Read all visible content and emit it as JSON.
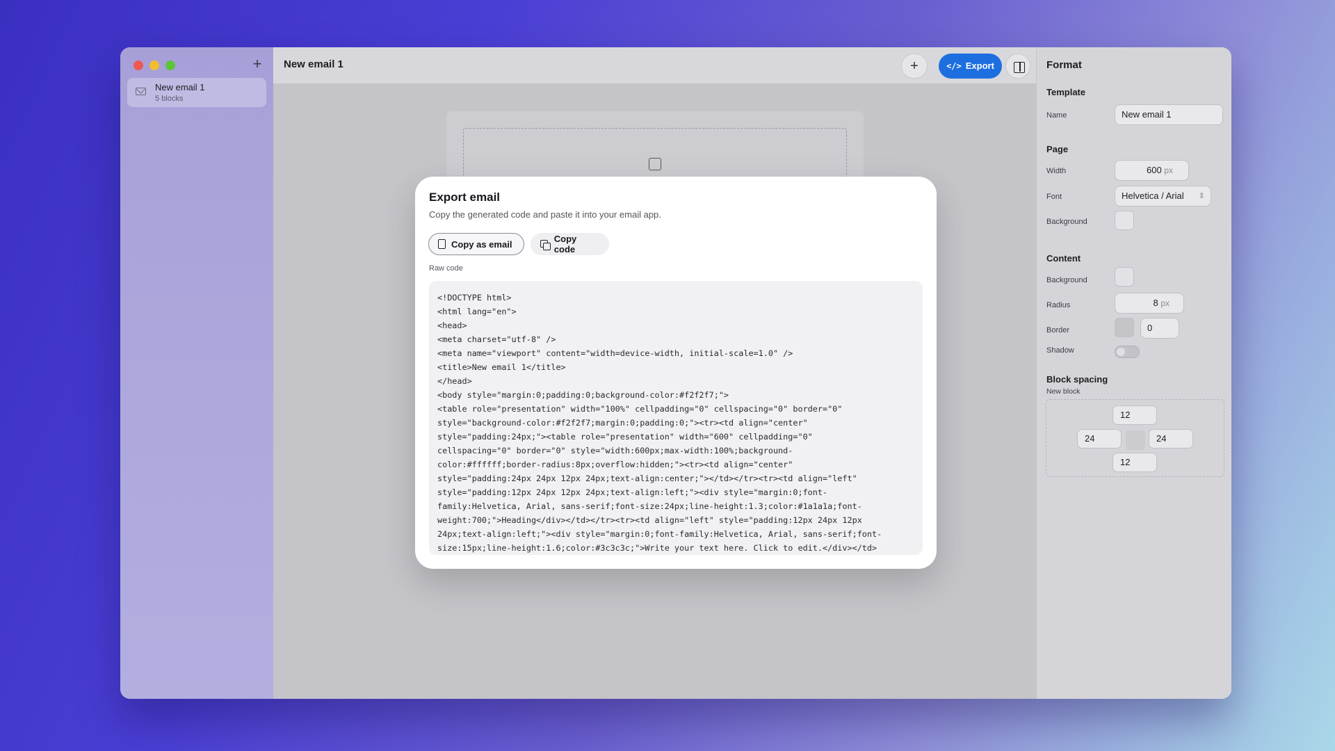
{
  "sidebar": {
    "add_label": "+",
    "items": [
      {
        "title": "New email 1",
        "subtitle": "5 blocks"
      }
    ]
  },
  "header": {
    "title": "New email 1",
    "add_label": "+",
    "export_label": "Export",
    "export_icon": "code-icon",
    "panel_icon": "sidebar-toggle-icon"
  },
  "format": {
    "title": "Format",
    "template": {
      "section": "Template",
      "name_label": "Name",
      "name_value": "New email 1"
    },
    "page": {
      "section": "Page",
      "width_label": "Width",
      "width_value": "600",
      "width_unit": "px",
      "font_label": "Font",
      "font_value": "Helvetica / Arial",
      "background_label": "Background",
      "background_color": "#f2f2f7"
    },
    "content": {
      "section": "Content",
      "background_label": "Background",
      "background_color": "#ffffff",
      "radius_label": "Radius",
      "radius_value": "8",
      "radius_unit": "px",
      "border_label": "Border",
      "border_color": "#c8c8cc",
      "border_value": "0",
      "shadow_label": "Shadow",
      "shadow_on": false
    },
    "block_spacing": {
      "section": "Block spacing",
      "sub": "New block",
      "top": "12",
      "left": "24",
      "right": "24",
      "bottom": "12"
    }
  },
  "modal": {
    "title": "Export email",
    "description": "Copy the generated code and paste it into your email app.",
    "copy_email_label": "Copy as email",
    "copy_code_label": "Copy code",
    "raw_label": "Raw code",
    "code_lines": [
      "<!DOCTYPE html>",
      "<html lang=\"en\">",
      "<head>",
      "<meta charset=\"utf-8\" />",
      "<meta name=\"viewport\" content=\"width=device-width, initial-scale=1.0\" />",
      "<title>New email 1</title>",
      "</head>",
      "<body style=\"margin:0;padding:0;background-color:#f2f2f7;\">",
      "<table role=\"presentation\" width=\"100%\" cellpadding=\"0\" cellspacing=\"0\" border=\"0\"",
      "style=\"background-color:#f2f2f7;margin:0;padding:0;\"><tr><td align=\"center\"",
      "style=\"padding:24px;\"><table role=\"presentation\" width=\"600\" cellpadding=\"0\"",
      "cellspacing=\"0\" border=\"0\" style=\"width:600px;max-width:100%;background-",
      "color:#ffffff;border-radius:8px;overflow:hidden;\"><tr><td align=\"center\"",
      "style=\"padding:24px 24px 12px 24px;text-align:center;\"></td></tr><tr><td align=\"left\"",
      "style=\"padding:12px 24px 12px 24px;text-align:left;\"><div style=\"margin:0;font-",
      "family:Helvetica, Arial, sans-serif;font-size:24px;line-height:1.3;color:#1a1a1a;font-",
      "weight:700;\">Heading</div></td></tr><tr><td align=\"left\" style=\"padding:12px 24px 12px",
      "24px;text-align:left;\"><div style=\"margin:0;font-family:Helvetica, Arial, sans-serif;font-",
      "size:15px;line-height:1.6;color:#3c3c3c;\">Write your text here. Click to edit.</div></td>"
    ]
  },
  "colors": {
    "accent": "#1d6fe0",
    "traffic_red": "#ee5a52",
    "traffic_yellow": "#f2bd2f",
    "traffic_green": "#5dc43b"
  }
}
